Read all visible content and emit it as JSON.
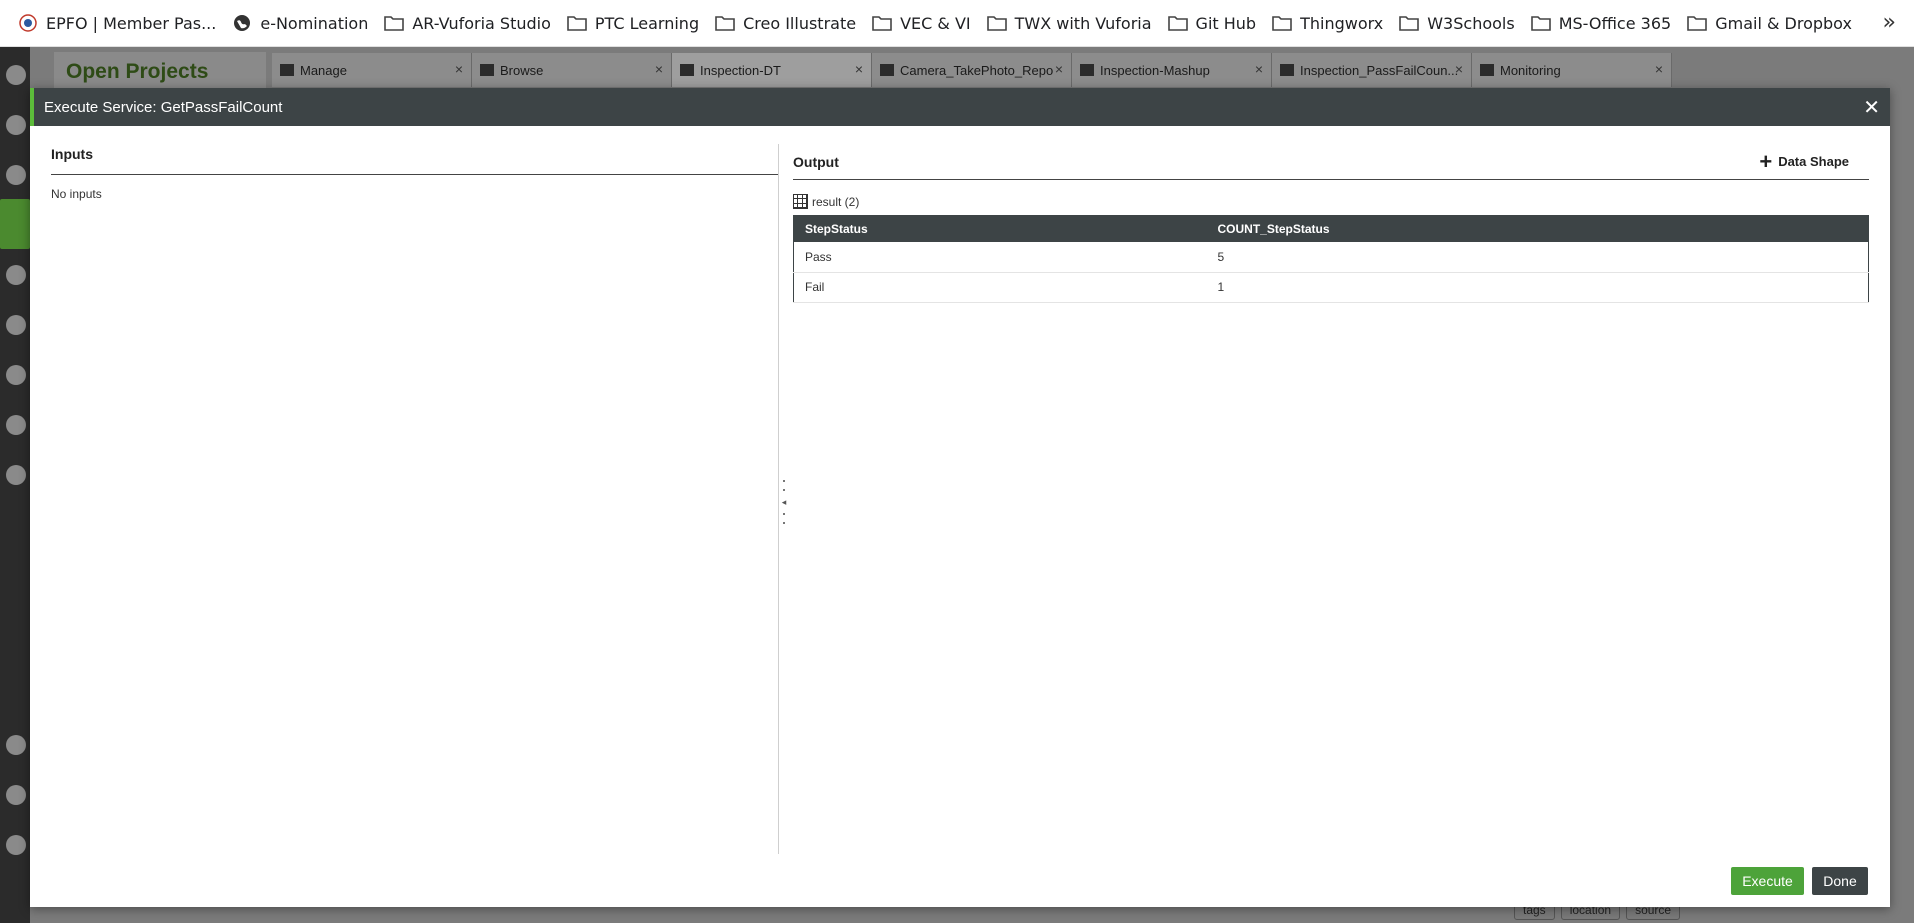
{
  "bookmarks": [
    {
      "label": "EPFO | Member Pas...",
      "icon": "epfo-logo-icon"
    },
    {
      "label": "e-Nomination",
      "icon": "globe-icon"
    },
    {
      "label": "AR-Vuforia Studio",
      "icon": "folder-icon"
    },
    {
      "label": "PTC Learning",
      "icon": "folder-icon"
    },
    {
      "label": "Creo Illustrate",
      "icon": "folder-icon"
    },
    {
      "label": "VEC & VI",
      "icon": "folder-icon"
    },
    {
      "label": "TWX with Vuforia",
      "icon": "folder-icon"
    },
    {
      "label": "Git Hub",
      "icon": "folder-icon"
    },
    {
      "label": "Thingworx",
      "icon": "folder-icon"
    },
    {
      "label": "W3Schools",
      "icon": "folder-icon"
    },
    {
      "label": "MS-Office 365",
      "icon": "folder-icon"
    },
    {
      "label": "Gmail & Dropbox",
      "icon": "folder-icon"
    }
  ],
  "bookmarks_more": "»",
  "background": {
    "open_projects": "Open Projects",
    "tabs": [
      {
        "label": "Manage"
      },
      {
        "label": "Browse"
      },
      {
        "label": "Inspection-DT"
      },
      {
        "label": "Camera_TakePhoto_Repo"
      },
      {
        "label": "Inspection-Mashup"
      },
      {
        "label": "Inspection_PassFailCoun..."
      },
      {
        "label": "Monitoring"
      }
    ],
    "bottom_tags": [
      "tags",
      "location",
      "source"
    ]
  },
  "dialog": {
    "title": "Execute Service: GetPassFailCount",
    "close": "✕",
    "inputs_title": "Inputs",
    "no_inputs": "No inputs",
    "output_title": "Output",
    "data_shape_label": "Data Shape",
    "result_label": "result (2)",
    "columns": [
      "StepStatus",
      "COUNT_StepStatus"
    ],
    "rows": [
      [
        "Pass",
        "5"
      ],
      [
        "Fail",
        "1"
      ]
    ],
    "execute_label": "Execute",
    "done_label": "Done"
  },
  "colors": {
    "header_bg": "#3d4446",
    "accent_green": "#4da33a"
  }
}
